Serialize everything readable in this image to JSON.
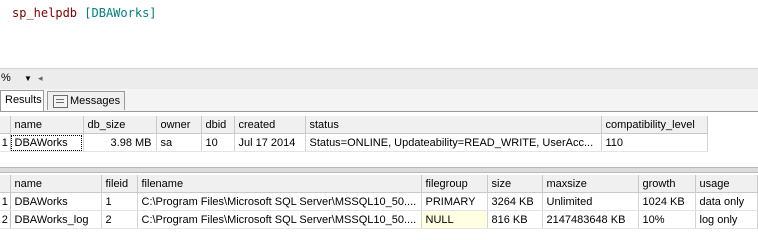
{
  "editor": {
    "keyword": "sp_helpdb",
    "argument": "[DBAWorks]"
  },
  "zoom": {
    "value": "%",
    "dropdown_icon": "chevron-down-icon"
  },
  "tabs": [
    {
      "label": "Results",
      "active": true
    },
    {
      "label": "Messages",
      "active": false,
      "icon": "messages-icon"
    }
  ],
  "grid1": {
    "columns": [
      "name",
      "db_size",
      "owner",
      "dbid",
      "created",
      "status",
      "compatibility_level"
    ],
    "rows": [
      [
        "DBAWorks",
        "3.98 MB",
        "sa",
        "10",
        "Jul 17 2014",
        "Status=ONLINE, Updateability=READ_WRITE, UserAcc...",
        "110"
      ]
    ],
    "row_numbers": [
      "1"
    ]
  },
  "grid2": {
    "columns": [
      "name",
      "fileid",
      "filename",
      "filegroup",
      "size",
      "maxsize",
      "growth",
      "usage"
    ],
    "rows": [
      [
        "DBAWorks",
        "1",
        "C:\\Program Files\\Microsoft SQL Server\\MSSQL10_50....",
        "PRIMARY",
        "3264 KB",
        "Unlimited",
        "1024 KB",
        "data only"
      ],
      [
        "DBAWorks_log",
        "2",
        "C:\\Program Files\\Microsoft SQL Server\\MSSQL10_50....",
        "NULL",
        "816 KB",
        "2147483648 KB",
        "10%",
        "log only"
      ]
    ],
    "row_numbers": [
      "1",
      "2"
    ]
  },
  "colors": {
    "keyword": "#800000",
    "identifier": "#008080",
    "null_highlight": "#ffffe1"
  }
}
